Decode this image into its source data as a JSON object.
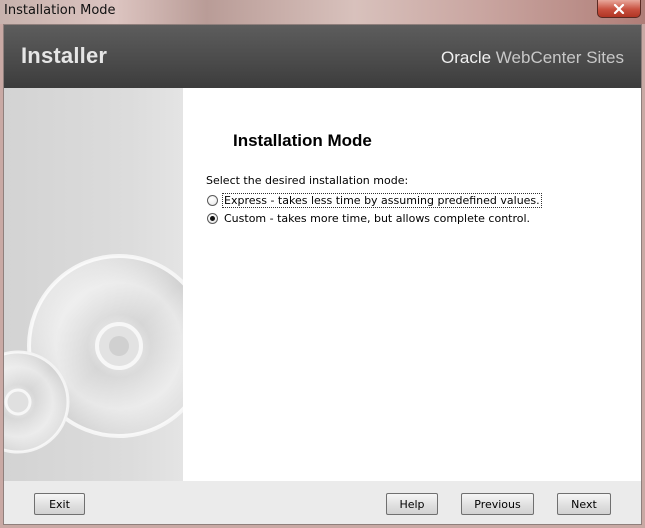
{
  "window": {
    "title": "Installation Mode",
    "close_icon": "close-icon"
  },
  "header": {
    "app_name": "Installer",
    "brand_primary": "Oracle",
    "brand_secondary": "WebCenter Sites"
  },
  "main": {
    "title": "Installation Mode",
    "prompt": "Select the desired installation mode:",
    "options": [
      {
        "label": "Express - takes less time by assuming predefined values.",
        "selected": false,
        "focused": true
      },
      {
        "label": "Custom - takes more time, but allows complete control.",
        "selected": true,
        "focused": false
      }
    ]
  },
  "footer": {
    "exit_label": "Exit",
    "help_label": "Help",
    "previous_label": "Previous",
    "next_label": "Next"
  },
  "colors": {
    "header_bg": "#4a4a4a",
    "header_text": "#e6e6e6",
    "close_button": "#c8503f",
    "content_bg": "#ffffff"
  }
}
